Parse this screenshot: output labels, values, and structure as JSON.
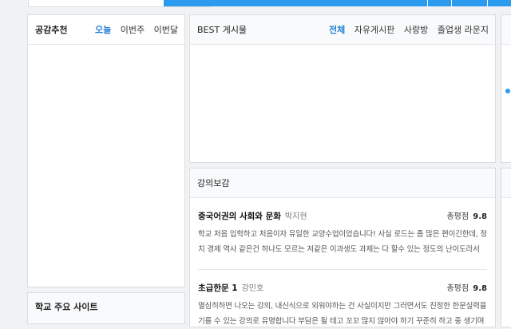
{
  "empathy_panel": {
    "title": "공감추천",
    "tabs": [
      "오늘",
      "이번주",
      "이번달"
    ]
  },
  "best_panel": {
    "title": "BEST 게시물",
    "tabs": [
      "전체",
      "자유게시판",
      "사랑방",
      "졸업생 라운지"
    ]
  },
  "lecture_panel": {
    "title": "강의보감",
    "reviews": [
      {
        "course": "중국어권의 사회와 문화",
        "professor": "박지현",
        "score_label": "총평점",
        "score": "9.8",
        "text": "학교 처음 입학하고 처음이자 유일한 교양수업이었습니다! 사실 로드는 좀 많은 편이긴한데, 정치 경제 역사 같은건 하나도 모르는 저같은 이과생도 과제는 다 할수 있는 정도의 난이도라서 괜찮았던 것"
      },
      {
        "course": "초급한문 1",
        "professor": "강민호",
        "score_label": "총평점",
        "score": "9.8",
        "text": "열심히하면 나오는 강의, 내신식으로 외워야하는 건 사실이지만 그러면서도 진정한 한문실력을 기를 수 있는 강의로 유명합니다 부담은 될 테고 꼬꼬 많지 않아야 하기 꾸준히 하고 중 생기며"
      }
    ]
  },
  "school_sites_panel": {
    "title": "학교 주요 사이트"
  }
}
